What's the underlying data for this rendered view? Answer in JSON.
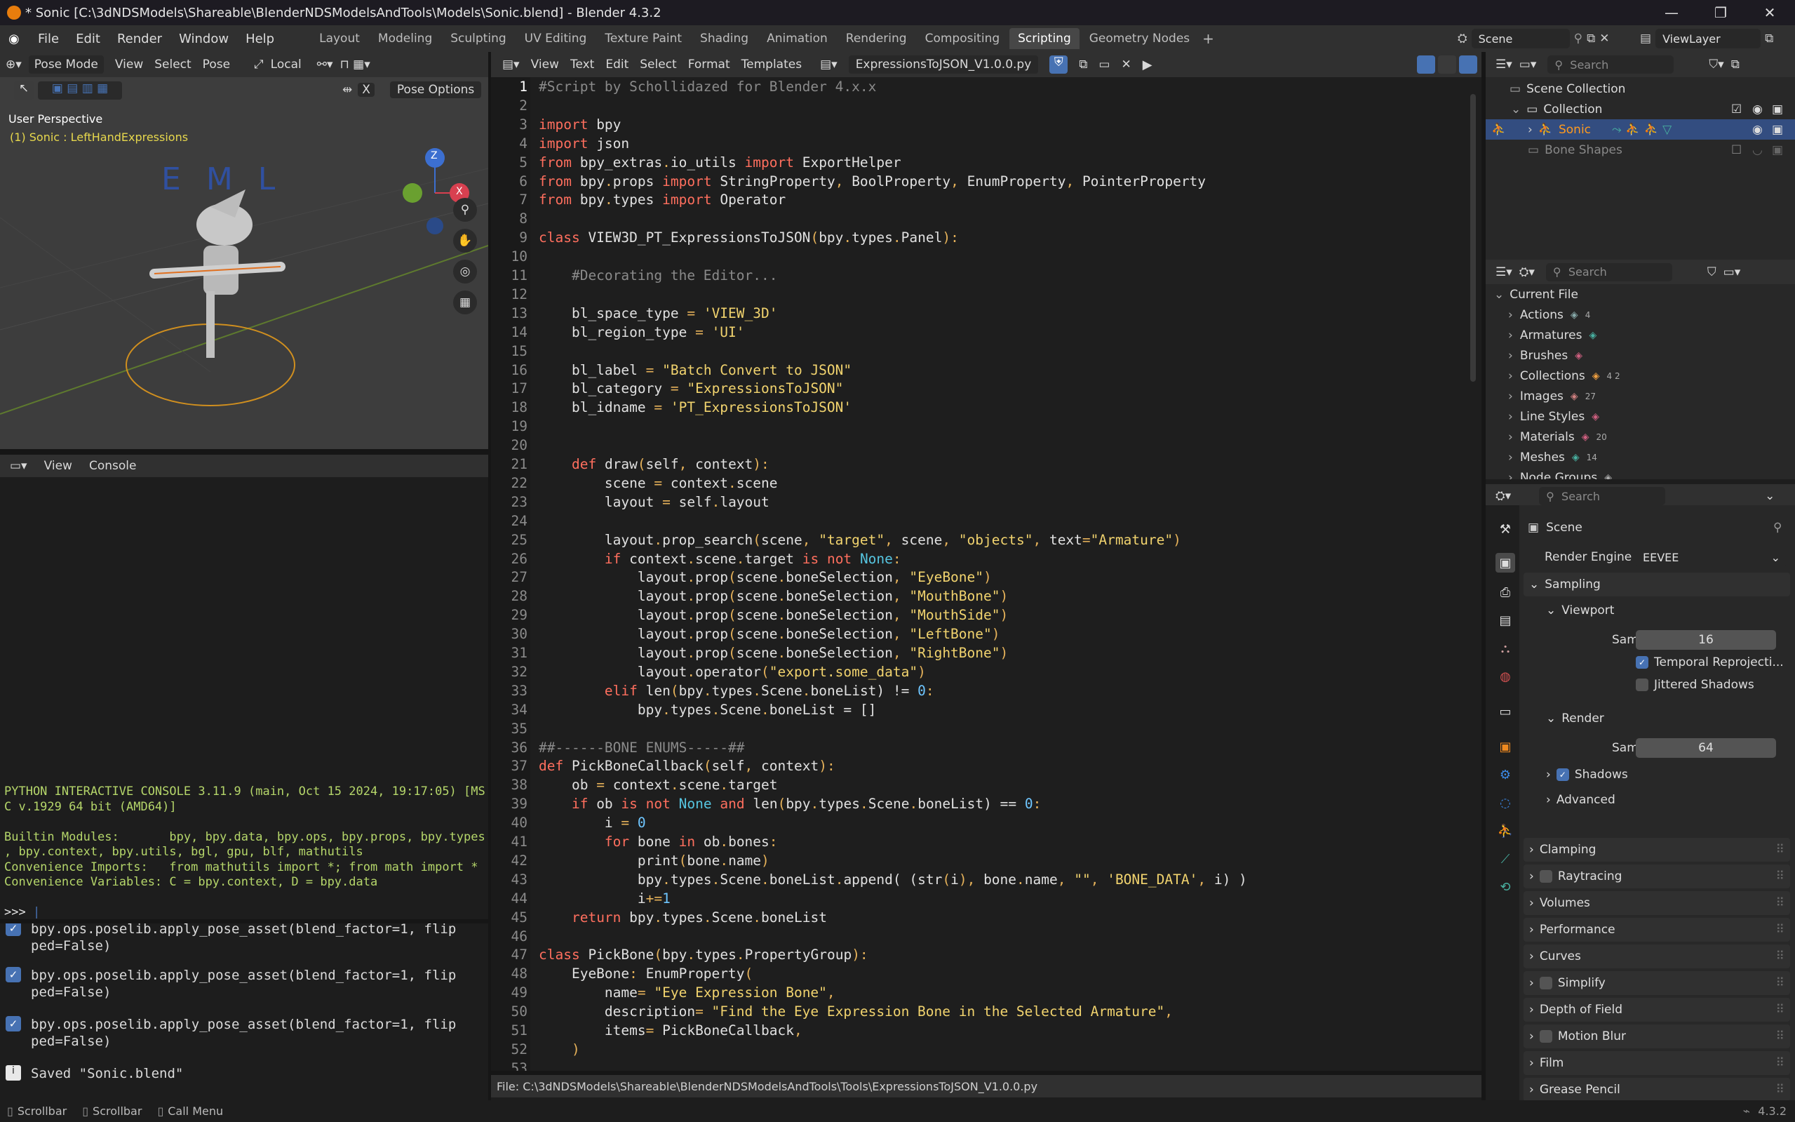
{
  "window": {
    "title": "* Sonic [C:\\3dNDSModels\\Shareable\\BlenderNDSModelsAndTools\\Models\\Sonic.blend] - Blender 4.3.2"
  },
  "menu": [
    "File",
    "Edit",
    "Render",
    "Window",
    "Help"
  ],
  "workspaces": [
    "Layout",
    "Modeling",
    "Sculpting",
    "UV Editing",
    "Texture Paint",
    "Shading",
    "Animation",
    "Rendering",
    "Compositing",
    "Scripting",
    "Geometry Nodes"
  ],
  "active_workspace": "Scripting",
  "scene": {
    "name": "Scene",
    "view_layer": "ViewLayer"
  },
  "viewport": {
    "mode": "Pose Mode",
    "menus": [
      "View",
      "Select",
      "Pose"
    ],
    "orientation": "Local",
    "pose_options": "Pose Options",
    "x_label": "X",
    "title": "User Perspective",
    "subtitle": "(1) Sonic : LeftHandExpressions",
    "gizmo_letters": [
      "E",
      "M",
      "L"
    ],
    "axes": {
      "z": "Z",
      "x": "X"
    }
  },
  "text_editor": {
    "menus": [
      "View",
      "Text",
      "Edit",
      "Select",
      "Format",
      "Templates"
    ],
    "filename": "ExpressionsToJSON_V1.0.0.py",
    "footer": "File: C:\\3dNDSModels\\Shareable\\BlenderNDSModelsAndTools\\Tools\\ExpressionsToJSON_V1.0.0.py",
    "lines": [
      {
        "n": "1",
        "t": "#Script by Schollidazed for Blender 4.x.x"
      },
      {
        "n": "2",
        "t": ""
      },
      {
        "n": "3",
        "t": "import bpy"
      },
      {
        "n": "4",
        "t": "import json"
      },
      {
        "n": "5",
        "t": "from bpy_extras.io_utils import ExportHelper"
      },
      {
        "n": "6",
        "t": "from bpy.props import StringProperty, BoolProperty, EnumProperty, PointerProperty"
      },
      {
        "n": "7",
        "t": "from bpy.types import Operator"
      },
      {
        "n": "8",
        "t": ""
      },
      {
        "n": "9",
        "t": "class VIEW3D_PT_ExpressionsToJSON(bpy.types.Panel):"
      },
      {
        "n": "10",
        "t": ""
      },
      {
        "n": "11",
        "t": "    #Decorating the Editor..."
      },
      {
        "n": "12",
        "t": ""
      },
      {
        "n": "13",
        "t": "    bl_space_type = 'VIEW_3D'"
      },
      {
        "n": "14",
        "t": "    bl_region_type = 'UI'"
      },
      {
        "n": "15",
        "t": ""
      },
      {
        "n": "16",
        "t": "    bl_label = \"Batch Convert to JSON\""
      },
      {
        "n": "17",
        "t": "    bl_category = \"ExpressionsToJSON\""
      },
      {
        "n": "18",
        "t": "    bl_idname = 'PT_ExpressionsToJSON'"
      },
      {
        "n": "19",
        "t": ""
      },
      {
        "n": "20",
        "t": ""
      },
      {
        "n": "21",
        "t": "    def draw(self, context):"
      },
      {
        "n": "22",
        "t": "        scene = context.scene"
      },
      {
        "n": "23",
        "t": "        layout = self.layout"
      },
      {
        "n": "24",
        "t": ""
      },
      {
        "n": "25",
        "t": "        layout.prop_search(scene, \"target\", scene, \"objects\", text=\"Armature\")"
      },
      {
        "n": "26",
        "t": "        if context.scene.target is not None:"
      },
      {
        "n": "27",
        "t": "            layout.prop(scene.boneSelection, \"EyeBone\")"
      },
      {
        "n": "28",
        "t": "            layout.prop(scene.boneSelection, \"MouthBone\")"
      },
      {
        "n": "29",
        "t": "            layout.prop(scene.boneSelection, \"MouthSide\")"
      },
      {
        "n": "30",
        "t": "            layout.prop(scene.boneSelection, \"LeftBone\")"
      },
      {
        "n": "31",
        "t": "            layout.prop(scene.boneSelection, \"RightBone\")"
      },
      {
        "n": "32",
        "t": "            layout.operator(\"export.some_data\")"
      },
      {
        "n": "33",
        "t": "        elif len(bpy.types.Scene.boneList) != 0:"
      },
      {
        "n": "34",
        "t": "            bpy.types.Scene.boneList = []"
      },
      {
        "n": "35",
        "t": ""
      },
      {
        "n": "36",
        "t": "##------BONE ENUMS-----##"
      },
      {
        "n": "37",
        "t": "def PickBoneCallback(self, context):"
      },
      {
        "n": "38",
        "t": "    ob = context.scene.target"
      },
      {
        "n": "39",
        "t": "    if ob is not None and len(bpy.types.Scene.boneList) == 0:"
      },
      {
        "n": "40",
        "t": "        i = 0"
      },
      {
        "n": "41",
        "t": "        for bone in ob.bones:"
      },
      {
        "n": "42",
        "t": "            print(bone.name)"
      },
      {
        "n": "43",
        "t": "            bpy.types.Scene.boneList.append( (str(i), bone.name, \"\", 'BONE_DATA', i) )"
      },
      {
        "n": "44",
        "t": "            i+=1"
      },
      {
        "n": "45",
        "t": "    return bpy.types.Scene.boneList"
      },
      {
        "n": "46",
        "t": ""
      },
      {
        "n": "47",
        "t": "class PickBone(bpy.types.PropertyGroup):"
      },
      {
        "n": "48",
        "t": "    EyeBone: EnumProperty("
      },
      {
        "n": "49",
        "t": "        name= \"Eye Expression Bone\","
      },
      {
        "n": "50",
        "t": "        description= \"Find the Eye Expression Bone in the Selected Armature\","
      },
      {
        "n": "51",
        "t": "        items= PickBoneCallback,"
      },
      {
        "n": "52",
        "t": "    )"
      },
      {
        "n": "53",
        "t": ""
      }
    ]
  },
  "console": {
    "menus": [
      "View",
      "Console"
    ],
    "lines": [
      "PYTHON INTERACTIVE CONSOLE 3.11.9 (main, Oct 15 2024, 19:17:05) [MS",
      "C v.1929 64 bit (AMD64)]",
      "",
      "Builtin Modules:       bpy, bpy.data, bpy.ops, bpy.props, bpy.types",
      ", bpy.context, bpy.utils, bgl, gpu, blf, mathutils",
      "Convenience Imports:   from mathutils import *; from math import *",
      "Convenience Variables: C = bpy.context, D = bpy.data"
    ],
    "prompt": ">>> "
  },
  "info": {
    "entries": [
      "bpy.ops.poselib.apply_pose_asset(blend_factor=1, flip\nped=False)",
      "bpy.ops.poselib.apply_pose_asset(blend_factor=1, flip\nped=False)",
      "bpy.ops.poselib.apply_pose_asset(blend_factor=1, flip\nped=False)"
    ],
    "saved": "Saved \"Sonic.blend\""
  },
  "outliner": {
    "search_placeholder": "Search",
    "items": [
      "Scene Collection",
      "Collection",
      "Sonic",
      "Bone Shapes"
    ]
  },
  "data_api": {
    "search_placeholder": "Search",
    "root": "Current File",
    "items": [
      "Actions",
      "Armatures",
      "Brushes",
      "Collections",
      "Images",
      "Line Styles",
      "Materials",
      "Meshes",
      "Node Groups"
    ],
    "counts": [
      "4",
      "",
      "",
      "4  2",
      "27",
      "",
      "20",
      "14",
      ""
    ]
  },
  "properties": {
    "search_placeholder": "Search",
    "context": "Scene",
    "render_engine_label": "Render Engine",
    "render_engine": "EEVEE",
    "sampling": "Sampling",
    "viewport": "Viewport",
    "samples_label": "Samples",
    "viewport_samples": "16",
    "temporal": "Temporal Reprojecti...",
    "jittered": "Jittered Shadows",
    "render": "Render",
    "render_samples": "64",
    "shadows": "Shadows",
    "advanced": "Advanced",
    "sections": [
      "Clamping",
      "Raytracing",
      "Volumes",
      "Performance",
      "Curves",
      "Simplify",
      "Depth of Field",
      "Motion Blur",
      "Film",
      "Grease Pencil"
    ]
  },
  "statusbar": {
    "items": [
      "Scrollbar",
      "Scrollbar",
      "Call Menu"
    ],
    "version": "4.3.2"
  },
  "colors": {
    "accent": "#4772b3",
    "selected_row": "#334d80",
    "active_bone": "#ff9a1f",
    "console_green": "#b5d66a"
  }
}
